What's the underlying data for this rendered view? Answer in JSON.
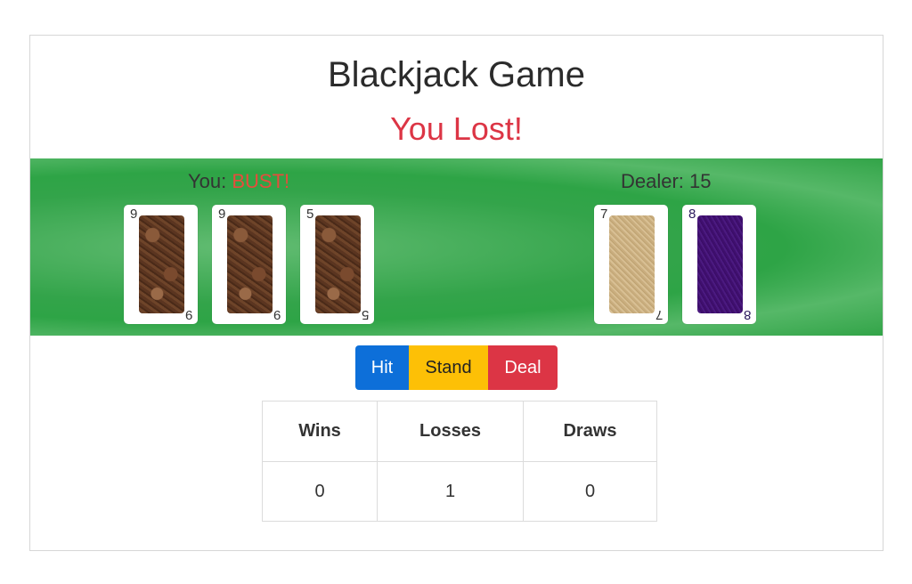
{
  "title": "Blackjack Game",
  "result": {
    "text": "You Lost!",
    "color": "#dc3545"
  },
  "player": {
    "label_prefix": "You: ",
    "status": "BUST!",
    "status_color": "#e74c3c",
    "cards": [
      {
        "rank": "9",
        "back": "brown"
      },
      {
        "rank": "9",
        "back": "brown"
      },
      {
        "rank": "5",
        "back": "brown"
      }
    ]
  },
  "dealer": {
    "label": "Dealer: 15",
    "cards": [
      {
        "rank": "7",
        "back": "sand"
      },
      {
        "rank": "8",
        "back": "purple"
      }
    ]
  },
  "buttons": {
    "hit": "Hit",
    "stand": "Stand",
    "deal": "Deal"
  },
  "stats": {
    "headers": [
      "Wins",
      "Losses",
      "Draws"
    ],
    "values": [
      "0",
      "1",
      "0"
    ]
  },
  "colors": {
    "table_green": "#33a44a",
    "hit_blue": "#0d6fd9",
    "stand_yellow": "#fdc006",
    "deal_red": "#dc3545"
  }
}
